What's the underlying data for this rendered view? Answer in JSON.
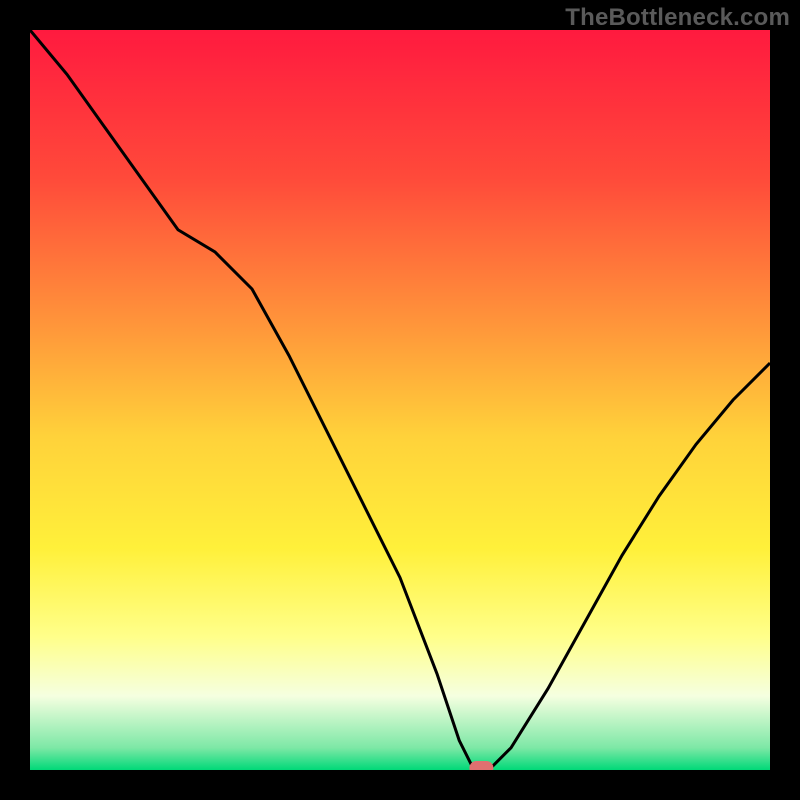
{
  "watermark": "TheBottleneck.com",
  "chart_data": {
    "type": "line",
    "title": "",
    "xlabel": "",
    "ylabel": "",
    "xlim": [
      0,
      100
    ],
    "ylim": [
      0,
      100
    ],
    "grid": false,
    "legend": false,
    "background_gradient": {
      "orientation": "vertical",
      "stops": [
        {
          "pos": 0.0,
          "color": "#ff1a3f"
        },
        {
          "pos": 0.2,
          "color": "#ff4a3a"
        },
        {
          "pos": 0.4,
          "color": "#ff963a"
        },
        {
          "pos": 0.55,
          "color": "#ffd23a"
        },
        {
          "pos": 0.7,
          "color": "#fff03a"
        },
        {
          "pos": 0.82,
          "color": "#ffff8a"
        },
        {
          "pos": 0.9,
          "color": "#f5ffe0"
        },
        {
          "pos": 0.97,
          "color": "#7de8a6"
        },
        {
          "pos": 1.0,
          "color": "#00d978"
        }
      ]
    },
    "series": [
      {
        "name": "bottleneck-curve",
        "color": "#000000",
        "x": [
          0,
          5,
          10,
          15,
          20,
          25,
          30,
          35,
          40,
          45,
          50,
          55,
          58,
          60,
          62,
          65,
          70,
          75,
          80,
          85,
          90,
          95,
          100
        ],
        "y": [
          100,
          94,
          87,
          80,
          73,
          70,
          65,
          56,
          46,
          36,
          26,
          13,
          4,
          0,
          0,
          3,
          11,
          20,
          29,
          37,
          44,
          50,
          55
        ]
      }
    ],
    "marker": {
      "name": "optimal-point",
      "x": 61,
      "y": 0,
      "color": "#e07070",
      "shape": "pill"
    }
  }
}
